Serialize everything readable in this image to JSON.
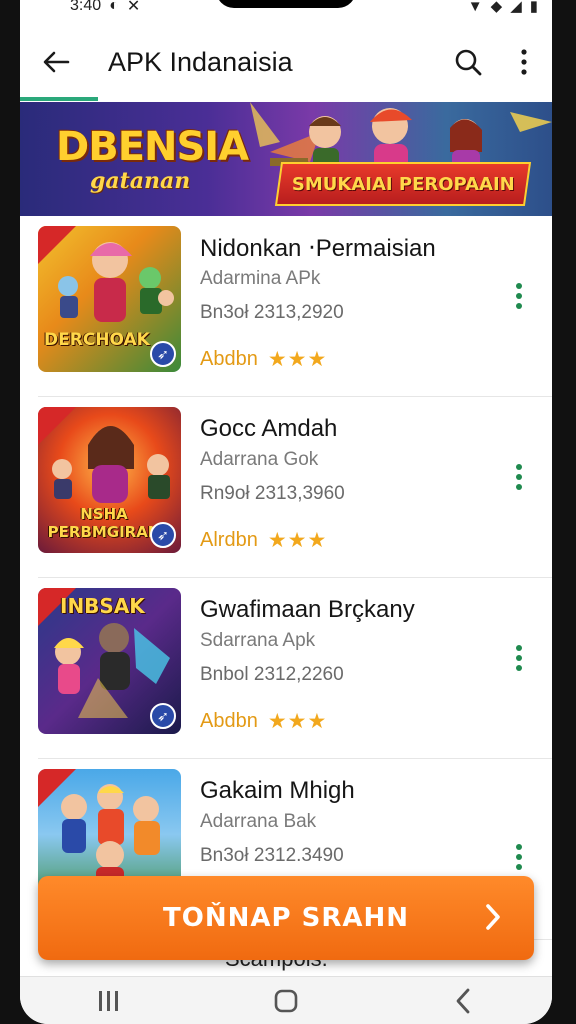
{
  "status_bar": {
    "time": "3:40"
  },
  "app_bar": {
    "title": "APK Indanaisia"
  },
  "banner": {
    "title": "DBENSIA",
    "subtitle": "gatanan",
    "ribbon_text": "SMUKAIAI PEROPAAIN"
  },
  "apps": [
    {
      "title": "Nidonkan ‧Permaisian",
      "developer": "Adarmina APk",
      "size": "Bn3oł 2313,2920",
      "rating_label": "Abdbn",
      "stars": "★★★",
      "thumb_text": "DERCHOAK",
      "thumb_colors": [
        "#f2c12e",
        "#3a8a3a"
      ]
    },
    {
      "title": "Gocc Amdah",
      "developer": "Adarrana Gok",
      "size": "Rn9oł 2313,3960",
      "rating_label": "Alrdbn",
      "stars": "★★★",
      "thumb_text": "NSHA PERBMGIRAN",
      "thumb_colors": [
        "#e84a1a",
        "#6a1a3a"
      ]
    },
    {
      "title": "Gwafimaan Brçkany",
      "developer": "Sdarrana Apk",
      "size": "Bnbol 2312,2260",
      "rating_label": "Abdbn",
      "stars": "★★★",
      "thumb_text": "INBSAK",
      "thumb_colors": [
        "#2a3a8a",
        "#1a1a4a"
      ]
    },
    {
      "title": "Gakaim Mhigh",
      "developer": "Adarrana Bak",
      "size": "Bn3oł 2312.3490",
      "rating_label": "",
      "stars": "",
      "thumb_text": "",
      "thumb_colors": [
        "#4aa8e8",
        "#3a8a3a"
      ]
    }
  ],
  "cta": {
    "label": "TOŇNAP SRAHN"
  },
  "peek_text": "Scampois."
}
